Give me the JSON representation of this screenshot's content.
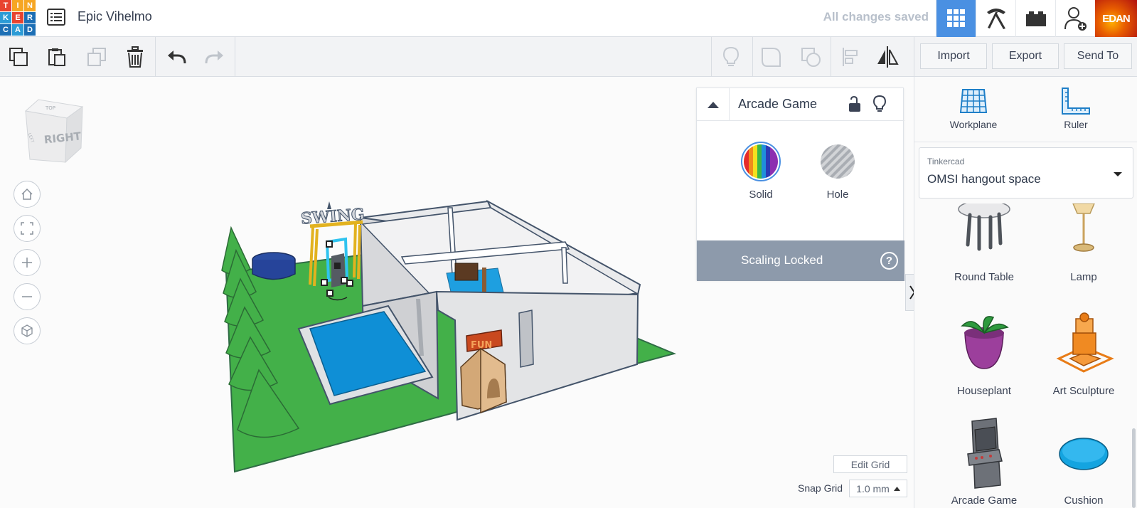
{
  "header": {
    "logo_letters": [
      "T",
      "I",
      "N",
      "K",
      "E",
      "R",
      "C",
      "A",
      "D"
    ],
    "design_title": "Epic Vihelmo",
    "save_status": "All changes saved",
    "avatar_text": "EDAN",
    "icons": [
      "menu-list-icon",
      "grid-view-icon",
      "pickaxe-icon",
      "bricks-icon",
      "user-add-icon"
    ]
  },
  "toolbar": {
    "import_label": "Import",
    "export_label": "Export",
    "send_to_label": "Send To"
  },
  "viewcube": {
    "face_label": "RIGHT",
    "top_label": "TOP",
    "side_label": "LEFT"
  },
  "inspector": {
    "title": "Arcade Game",
    "solid_label": "Solid",
    "hole_label": "Hole",
    "scaling_label": "Scaling Locked",
    "help_label": "?"
  },
  "scene": {
    "swing_sign": "SWING",
    "sign_text": "FUN"
  },
  "sidebar": {
    "workplane_label": "Workplane",
    "ruler_label": "Ruler",
    "library_caption": "Tinkercad",
    "library_value": "OMSI hangout space",
    "shapes": [
      {
        "label": "Round Table"
      },
      {
        "label": "Lamp"
      },
      {
        "label": "Houseplant"
      },
      {
        "label": "Art Sculpture"
      },
      {
        "label": "Arcade Game"
      },
      {
        "label": "Cushion"
      }
    ]
  },
  "grid": {
    "edit_label": "Edit Grid",
    "snap_label": "Snap Grid",
    "snap_value": "1.0 mm"
  },
  "colors": {
    "accent": "#4a90e2",
    "ground": "#43b049",
    "pool": "#0f8fd6",
    "scaling_bar": "#8d9aab"
  }
}
